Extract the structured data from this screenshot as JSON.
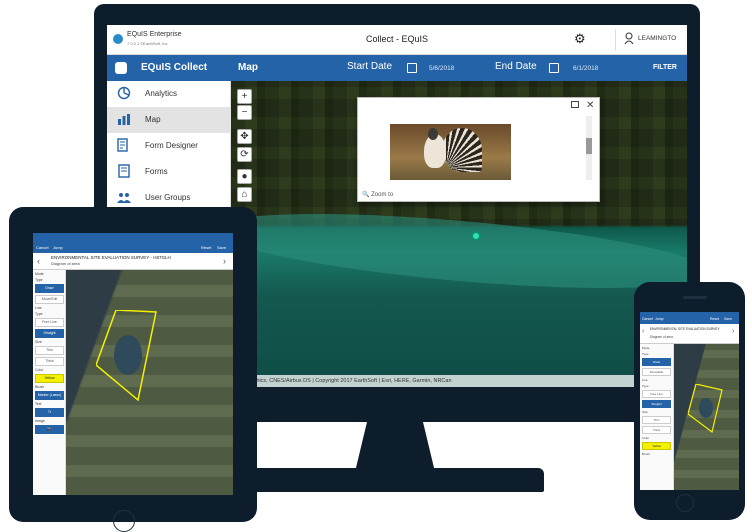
{
  "app": {
    "brand_name": "EQuIS Enterprise",
    "brand_sub": "7.0.0.1 ©EarthSoft, Inc.",
    "window_title": "Collect - EQuIS",
    "user_name": "LEAMINGTO"
  },
  "nav": {
    "app_name": "EQuIS Collect",
    "page": "Map",
    "start_label": "Start Date",
    "start_value": "5/6/2018",
    "end_label": "End Date",
    "end_value": "6/1/2018",
    "filter_label": "FILTER"
  },
  "sidebar": {
    "items": [
      {
        "label": "Analytics",
        "icon": "analytics-icon"
      },
      {
        "label": "Map",
        "icon": "map-icon"
      },
      {
        "label": "Form Designer",
        "icon": "form-designer-icon"
      },
      {
        "label": "Forms",
        "icon": "forms-icon"
      },
      {
        "label": "User Groups",
        "icon": "user-groups-icon"
      }
    ],
    "active_index": 1
  },
  "map": {
    "attribution": "Geographics, CNES/Airbus DS | Copyright 2017 EarthSoft | Esri, HERE, Garmin, NRCan",
    "tools": [
      "+",
      "−",
      "✥",
      "⟳",
      "●",
      "⌂"
    ],
    "popup": {
      "zoom_label": "Zoom to"
    }
  },
  "tablet": {
    "actions_left": [
      "Cancel",
      "Jump"
    ],
    "actions_right": [
      "Reset",
      "Save"
    ],
    "header_title": "ENVIRONMENTAL SITE EVALUATION SURVEY - H87GLH",
    "header_sub": "Diagram of area",
    "tools": [
      {
        "label": "Mode",
        "type": "label"
      },
      {
        "label": "Type",
        "type": "label"
      },
      {
        "label": "Draw",
        "type": "btn-blue"
      },
      {
        "label": "Move/Edit",
        "type": "btn"
      },
      {
        "label": "Line",
        "type": "label"
      },
      {
        "label": "Type",
        "type": "label"
      },
      {
        "label": "Free Line",
        "type": "btn"
      },
      {
        "label": "Straight",
        "type": "btn-blue"
      },
      {
        "label": "Size",
        "type": "label"
      },
      {
        "label": "Thin",
        "type": "btn"
      },
      {
        "label": "Thick",
        "type": "btn"
      },
      {
        "label": "Color",
        "type": "label"
      },
      {
        "label": "Yellow",
        "type": "btn-yellow"
      },
      {
        "label": "Brush",
        "type": "label"
      },
      {
        "label": "Marker (Lasso)",
        "type": "btn-blue"
      },
      {
        "label": "Text",
        "type": "label"
      },
      {
        "label": "Tr",
        "type": "btn-blue"
      },
      {
        "label": "Image",
        "type": "label"
      },
      {
        "label": "📷",
        "type": "btn-blue"
      }
    ]
  },
  "phone": {
    "actions_left": [
      "Cancel",
      "Jump"
    ],
    "actions_right": [
      "Reset",
      "Save"
    ],
    "header_title": "ENVIRONMENTAL SITE EVALUATION SURVEY",
    "header_sub": "Diagram of area",
    "tools": [
      {
        "label": "Mode",
        "type": "label"
      },
      {
        "label": "Type",
        "type": "label"
      },
      {
        "label": "Draw",
        "type": "btn-blue"
      },
      {
        "label": "Move/Edit",
        "type": "btn"
      },
      {
        "label": "Line",
        "type": "label"
      },
      {
        "label": "Type",
        "type": "label"
      },
      {
        "label": "Free Line",
        "type": "btn"
      },
      {
        "label": "Straight",
        "type": "btn-blue"
      },
      {
        "label": "Size",
        "type": "label"
      },
      {
        "label": "Thin",
        "type": "btn"
      },
      {
        "label": "Thick",
        "type": "btn"
      },
      {
        "label": "Color",
        "type": "label"
      },
      {
        "label": "Yellow",
        "type": "btn-yellow"
      },
      {
        "label": "Brush",
        "type": "label"
      }
    ]
  },
  "colors": {
    "accent": "#2563a8",
    "device": "#0d1d2b",
    "drawing": "#f3f002"
  }
}
